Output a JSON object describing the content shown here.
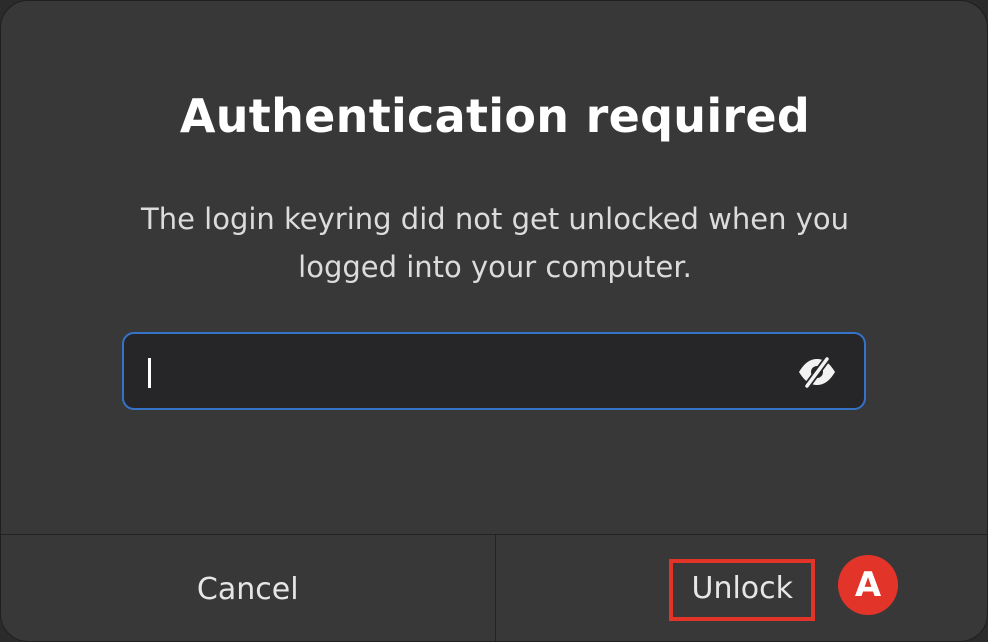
{
  "dialog": {
    "title": "Authentication required",
    "message": "The login keyring did not get unlocked when you logged into your computer.",
    "password": {
      "value": "",
      "reveal_icon": "eye-slash-icon"
    },
    "buttons": {
      "cancel_label": "Cancel",
      "unlock_label": "Unlock"
    }
  },
  "annotation": {
    "marker_label": "A",
    "color": "#e3342a"
  },
  "colors": {
    "focus_accent": "#3573c9",
    "dialog_bg": "#383838"
  }
}
